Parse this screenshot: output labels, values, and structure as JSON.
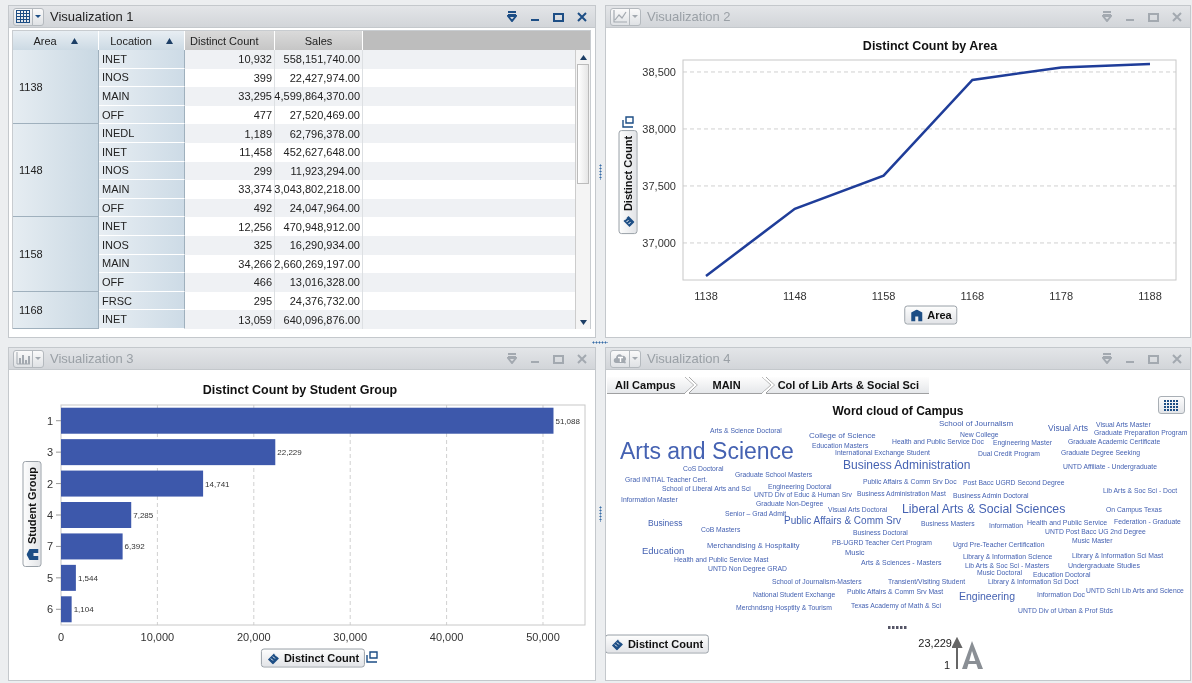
{
  "panels": [
    {
      "kind": "table",
      "title": "Visualization 1",
      "selected": true,
      "table": {
        "columns": [
          {
            "label": "Area",
            "sorted": true
          },
          {
            "label": "Location",
            "sorted": true
          },
          {
            "label": "Distinct Count",
            "sorted": false
          },
          {
            "label": "Sales",
            "sorted": false
          }
        ],
        "groups": [
          {
            "area": "1138",
            "rows": [
              {
                "location": "INET",
                "distinct_count": "10,932",
                "sales": "558,151,740.00"
              },
              {
                "location": "INOS",
                "distinct_count": "399",
                "sales": "22,427,974.00"
              },
              {
                "location": "MAIN",
                "distinct_count": "33,295",
                "sales": "4,599,864,370.00"
              },
              {
                "location": "OFF",
                "distinct_count": "477",
                "sales": "27,520,469.00"
              }
            ]
          },
          {
            "area": "1148",
            "rows": [
              {
                "location": "INEDL",
                "distinct_count": "1,189",
                "sales": "62,796,378.00"
              },
              {
                "location": "INET",
                "distinct_count": "11,458",
                "sales": "452,627,648.00"
              },
              {
                "location": "INOS",
                "distinct_count": "299",
                "sales": "11,923,294.00"
              },
              {
                "location": "MAIN",
                "distinct_count": "33,374",
                "sales": "3,043,802,218.00"
              },
              {
                "location": "OFF",
                "distinct_count": "492",
                "sales": "24,047,964.00"
              }
            ]
          },
          {
            "area": "1158",
            "rows": [
              {
                "location": "INET",
                "distinct_count": "12,256",
                "sales": "470,948,912.00"
              },
              {
                "location": "INOS",
                "distinct_count": "325",
                "sales": "16,290,934.00"
              },
              {
                "location": "MAIN",
                "distinct_count": "34,266",
                "sales": "2,660,269,197.00"
              },
              {
                "location": "OFF",
                "distinct_count": "466",
                "sales": "13,016,328.00"
              }
            ]
          },
          {
            "area": "1168",
            "rows": [
              {
                "location": "FRSC",
                "distinct_count": "295",
                "sales": "24,376,732.00"
              },
              {
                "location": "INET",
                "distinct_count": "13,059",
                "sales": "640,096,876.00"
              }
            ]
          }
        ]
      }
    },
    {
      "kind": "line",
      "title": "Visualization 2",
      "selected": false,
      "chart_data": {
        "type": "line",
        "title": "Distinct Count by Area",
        "xlabel": "Area",
        "ylabel": "Distinct Count",
        "x": [
          "1138",
          "1148",
          "1158",
          "1168",
          "1178",
          "1188"
        ],
        "series": [
          {
            "color": "#1f3d99",
            "values": [
              36710,
              37300,
              37590,
              38430,
              38540,
              38570
            ]
          }
        ],
        "grid": true,
        "ylim": [
          36675,
          38605
        ],
        "yticks": [
          {
            "value": 37000,
            "label": "37,000"
          },
          {
            "value": 37500,
            "label": "37,500"
          },
          {
            "value": 38000,
            "label": "38,000"
          },
          {
            "value": 38500,
            "label": "38,500"
          }
        ]
      }
    },
    {
      "kind": "bar",
      "title": "Visualization 3",
      "selected": false,
      "chart_data": {
        "type": "bar",
        "orientation": "horizontal",
        "title": "Distinct Count by Student Group",
        "xlabel": "Distinct Count",
        "ylabel": "Student Group",
        "categories": [
          "1",
          "3",
          "2",
          "4",
          "7",
          "5",
          "6"
        ],
        "series": [
          {
            "color": "#3d58ab",
            "values": [
              51088,
              22229,
              14741,
              7285,
              6392,
              1544,
              1104
            ]
          }
        ],
        "grid": true,
        "value_labels": [
          "51,088",
          "22,229",
          "14,741",
          "7,285",
          "6,392",
          "1,544",
          "1,104"
        ],
        "xlim": [
          0,
          54357
        ],
        "xticks": [
          {
            "value": 0,
            "label": "0"
          },
          {
            "value": 10000,
            "label": "10,000"
          },
          {
            "value": 20000,
            "label": "20,000"
          },
          {
            "value": 30000,
            "label": "30,000"
          },
          {
            "value": 40000,
            "label": "40,000"
          },
          {
            "value": 50000,
            "label": "50,000"
          }
        ]
      }
    },
    {
      "kind": "wordcloud",
      "title": "Visualization 4",
      "selected": false,
      "breadcrumb": [
        "All Campus",
        "MAIN",
        "Col of Lib Arts & Social Sci"
      ],
      "cloud_title": "Word cloud of Campus",
      "measure": "Distinct Count",
      "legend_max": "23,229",
      "legend_min": "1",
      "words": [
        "Arts & Science Doctoral",
        "College of Science",
        "School of Journalism",
        "New College",
        "Visual Arts",
        "Visual Arts Master",
        "Graduate Preparation Program",
        "Arts and Science",
        "Education Masters",
        "Health and Public Service Doc",
        "International Exchange Student",
        "Engineering Master",
        "Graduate Academic Certificate",
        "Dual Credit Program",
        "Graduate Degree Seeking",
        "CoS Doctoral",
        "Business Administration",
        "UNTD Affiliate - Undergraduate",
        "Grad INITIAL Teacher Cert.",
        "Graduate School Masters",
        "School of Liberal Arts and Sci",
        "Engineering Doctoral",
        "Public Affairs & Comm Srv Doc",
        "Post Bacc UGRD Second Degree",
        "Information Master",
        "UNTD Div of Educ & Human Srv",
        "Business Administration Mast",
        "Business Admin Doctoral",
        "Lib Arts & Soc Sci - Doct",
        "Graduate Non-Degree",
        "Senior – Grad Admit",
        "Visual Arts Doctoral",
        "Liberal Arts & Social Sciences",
        "On Campus Texas",
        "Business",
        "Public Affairs & Comm Srv",
        "Business Masters",
        "Information",
        "Health and Public Service",
        "Federation - Graduate",
        "CoB Masters",
        "Business Doctoral",
        "UNTD Post Bacc UG 2nd Degree",
        "Education",
        "Merchandising & Hospitality",
        "PB-UGRD Teacher Cert Program",
        "Music",
        "Ugrd Pre-Teacher Certification",
        "Music Master",
        "Health and Public Service Mast",
        "Arts & Sciences - Masters",
        "Library & Information Science",
        "Library & Information Sci Mast",
        "UNTD Non Degree GRAD",
        "Lib Arts & Soc Sci - Masters",
        "Undergraduate Studies",
        "Music Doctoral",
        "Education Doctoral",
        "School of Journalism-Masters",
        "Transient/Visiting Student",
        "Library & Information Sci Doct",
        "National Student Exchange",
        "Public Affairs & Comm Srv Mast",
        "Engineering",
        "Information Doc",
        "UNTD Schl Lib Arts and Science",
        "Merchndsng Hosptlty & Tourism",
        "Texas Academy of Math & Sci",
        "UNTD Div of Urban & Prof Stds"
      ]
    }
  ]
}
